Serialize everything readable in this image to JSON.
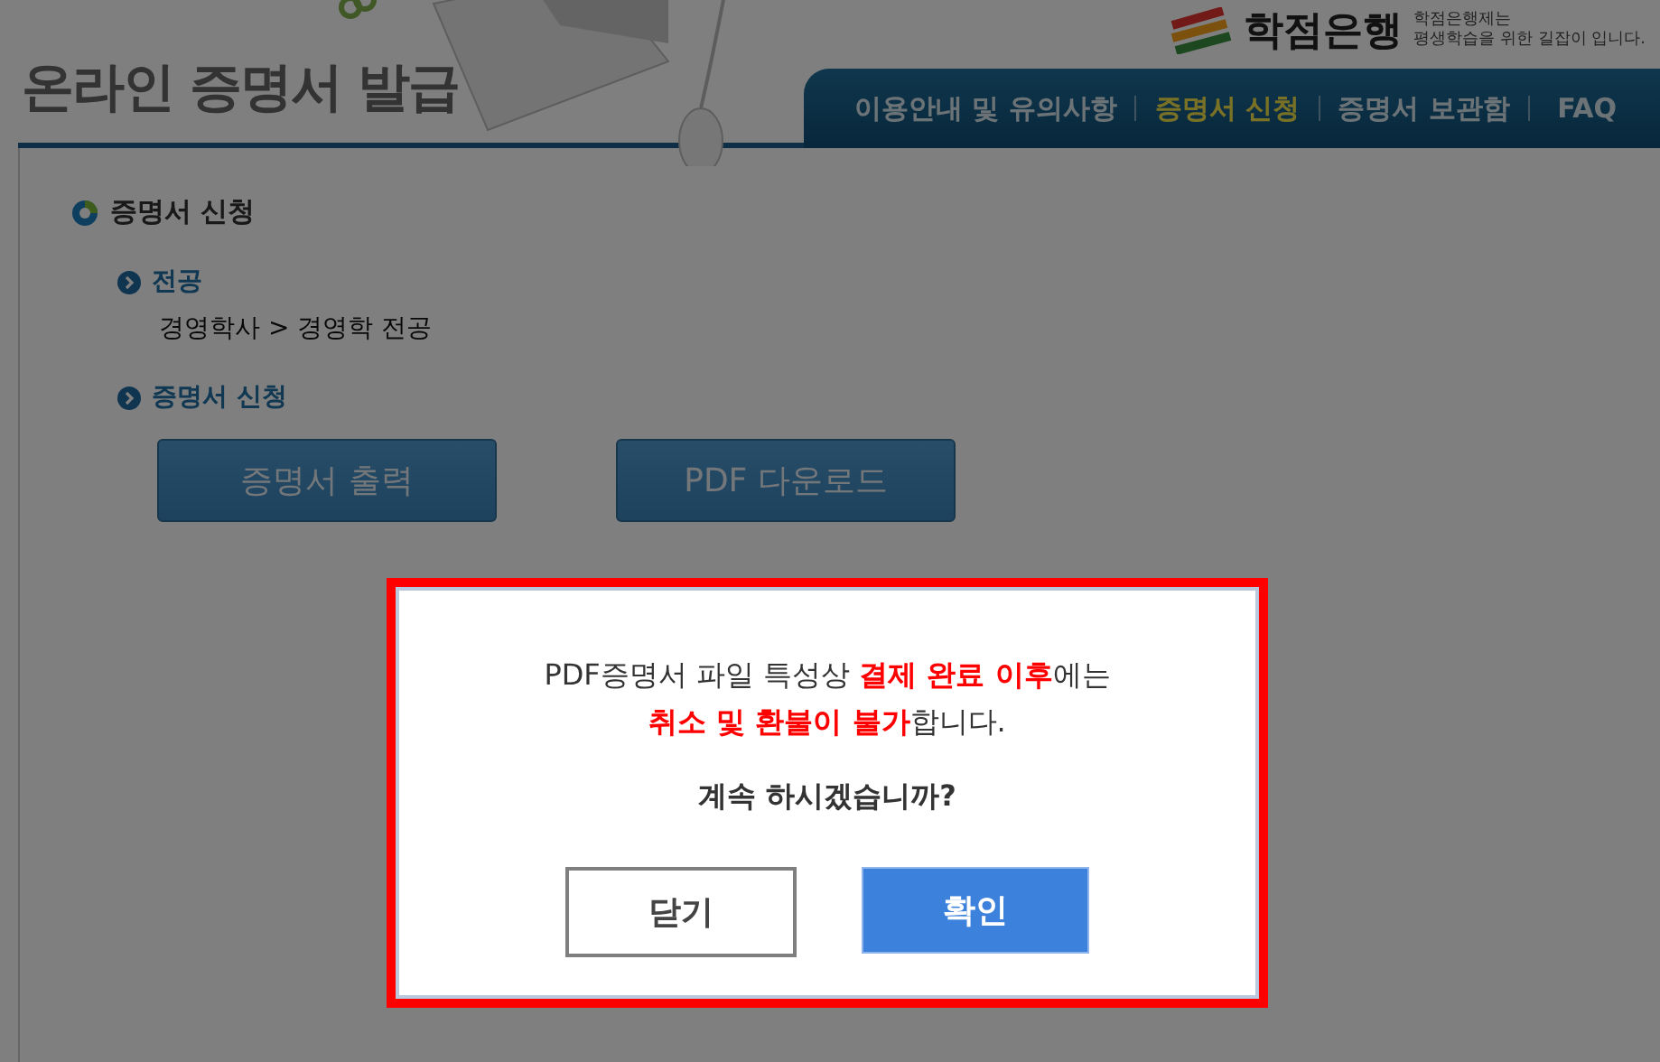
{
  "header": {
    "title": "온라인 증명서 발급",
    "logo_text": "학점은행",
    "tagline_lines": [
      "학점은행제는",
      "평생학습을 위한 길잡이 입니다."
    ]
  },
  "nav": {
    "items": [
      {
        "label": "이용안내 및 유의사항",
        "selected": false
      },
      {
        "label": "증명서 신청",
        "selected": true
      },
      {
        "label": "증명서 보관함",
        "selected": false
      },
      {
        "label": "FAQ",
        "selected": false
      }
    ]
  },
  "content": {
    "section_title": "증명서 신청",
    "major": {
      "heading": "전공",
      "value": "경영학사 > 경영학 전공"
    },
    "apply": {
      "heading": "증명서 신청",
      "buttons": [
        "증명서 출력",
        "PDF 다운로드"
      ]
    }
  },
  "dialog": {
    "message_lines": [
      "PDF증명서 파일 특성상 **결제 완료 이후**에는",
      "**취소 및 환불이 불가**합니다."
    ],
    "question": "계속 하시겠습니까?",
    "buttons": [
      {
        "label": "닫기",
        "kind": "secondary"
      },
      {
        "label": "확인",
        "kind": "primary"
      }
    ]
  }
}
